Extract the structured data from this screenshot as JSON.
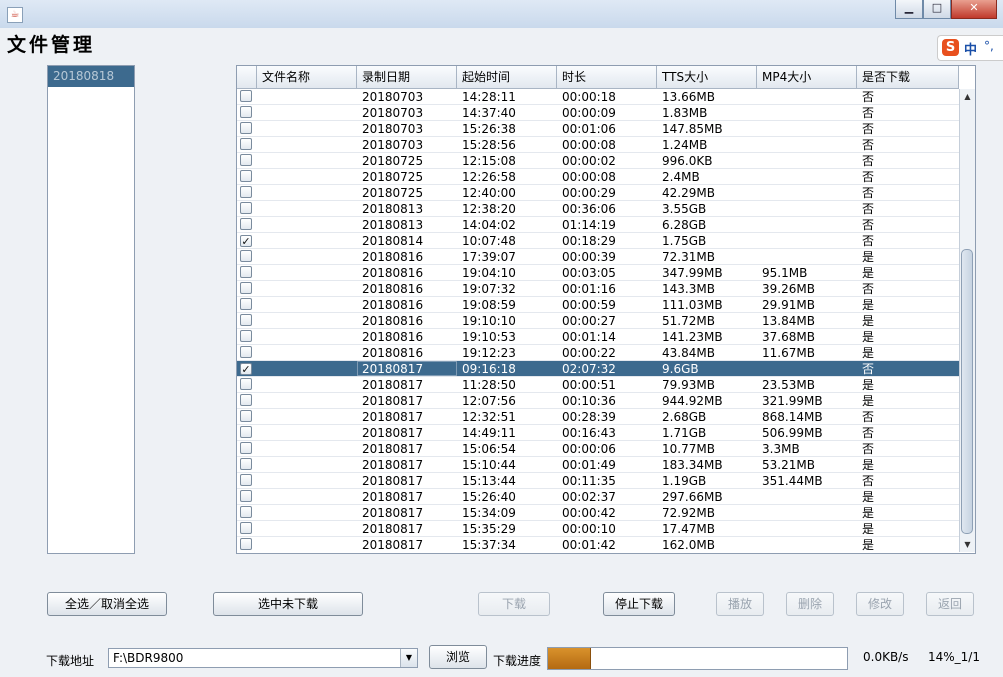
{
  "window": {
    "title_icon": "java-app-icon"
  },
  "page_title": "文件管理",
  "ime": {
    "logo": "S",
    "mode": "中",
    "indicator": "°,"
  },
  "date_list": [
    "20180818"
  ],
  "table": {
    "columns": [
      "文件名称",
      "录制日期",
      "起始时间",
      "时长",
      "TTS大小",
      "MP4大小",
      "是否下载"
    ],
    "rows": [
      {
        "checked": false,
        "name": "",
        "date": "20180703",
        "start": "14:28:11",
        "duration": "00:00:18",
        "tts": "13.66MB",
        "mp4": "",
        "downloaded": "否"
      },
      {
        "checked": false,
        "name": "",
        "date": "20180703",
        "start": "14:37:40",
        "duration": "00:00:09",
        "tts": "1.83MB",
        "mp4": "",
        "downloaded": "否"
      },
      {
        "checked": false,
        "name": "",
        "date": "20180703",
        "start": "15:26:38",
        "duration": "00:01:06",
        "tts": "147.85MB",
        "mp4": "",
        "downloaded": "否"
      },
      {
        "checked": false,
        "name": "",
        "date": "20180703",
        "start": "15:28:56",
        "duration": "00:00:08",
        "tts": "1.24MB",
        "mp4": "",
        "downloaded": "否"
      },
      {
        "checked": false,
        "name": "",
        "date": "20180725",
        "start": "12:15:08",
        "duration": "00:00:02",
        "tts": "996.0KB",
        "mp4": "",
        "downloaded": "否"
      },
      {
        "checked": false,
        "name": "",
        "date": "20180725",
        "start": "12:26:58",
        "duration": "00:00:08",
        "tts": "2.4MB",
        "mp4": "",
        "downloaded": "否"
      },
      {
        "checked": false,
        "name": "",
        "date": "20180725",
        "start": "12:40:00",
        "duration": "00:00:29",
        "tts": "42.29MB",
        "mp4": "",
        "downloaded": "否"
      },
      {
        "checked": false,
        "name": "",
        "date": "20180813",
        "start": "12:38:20",
        "duration": "00:36:06",
        "tts": "3.55GB",
        "mp4": "",
        "downloaded": "否"
      },
      {
        "checked": false,
        "name": "",
        "date": "20180813",
        "start": "14:04:02",
        "duration": "01:14:19",
        "tts": "6.28GB",
        "mp4": "",
        "downloaded": "否"
      },
      {
        "checked": true,
        "name": "",
        "date": "20180814",
        "start": "10:07:48",
        "duration": "00:18:29",
        "tts": "1.75GB",
        "mp4": "",
        "downloaded": "否"
      },
      {
        "checked": false,
        "name": "",
        "date": "20180816",
        "start": "17:39:07",
        "duration": "00:00:39",
        "tts": "72.31MB",
        "mp4": "",
        "downloaded": "是"
      },
      {
        "checked": false,
        "name": "",
        "date": "20180816",
        "start": "19:04:10",
        "duration": "00:03:05",
        "tts": "347.99MB",
        "mp4": "95.1MB",
        "downloaded": "是"
      },
      {
        "checked": false,
        "name": "",
        "date": "20180816",
        "start": "19:07:32",
        "duration": "00:01:16",
        "tts": "143.3MB",
        "mp4": "39.26MB",
        "downloaded": "否"
      },
      {
        "checked": false,
        "name": "",
        "date": "20180816",
        "start": "19:08:59",
        "duration": "00:00:59",
        "tts": "111.03MB",
        "mp4": "29.91MB",
        "downloaded": "是"
      },
      {
        "checked": false,
        "name": "",
        "date": "20180816",
        "start": "19:10:10",
        "duration": "00:00:27",
        "tts": "51.72MB",
        "mp4": "13.84MB",
        "downloaded": "是"
      },
      {
        "checked": false,
        "name": "",
        "date": "20180816",
        "start": "19:10:53",
        "duration": "00:01:14",
        "tts": "141.23MB",
        "mp4": "37.68MB",
        "downloaded": "是"
      },
      {
        "checked": false,
        "name": "",
        "date": "20180816",
        "start": "19:12:23",
        "duration": "00:00:22",
        "tts": "43.84MB",
        "mp4": "11.67MB",
        "downloaded": "是"
      },
      {
        "checked": true,
        "name": "",
        "date": "20180817",
        "start": "09:16:18",
        "duration": "02:07:32",
        "tts": "9.6GB",
        "mp4": "",
        "downloaded": "否",
        "selected": true
      },
      {
        "checked": false,
        "name": "",
        "date": "20180817",
        "start": "11:28:50",
        "duration": "00:00:51",
        "tts": "79.93MB",
        "mp4": "23.53MB",
        "downloaded": "是"
      },
      {
        "checked": false,
        "name": "",
        "date": "20180817",
        "start": "12:07:56",
        "duration": "00:10:36",
        "tts": "944.92MB",
        "mp4": "321.99MB",
        "downloaded": "是"
      },
      {
        "checked": false,
        "name": "",
        "date": "20180817",
        "start": "12:32:51",
        "duration": "00:28:39",
        "tts": "2.68GB",
        "mp4": "868.14MB",
        "downloaded": "否"
      },
      {
        "checked": false,
        "name": "",
        "date": "20180817",
        "start": "14:49:11",
        "duration": "00:16:43",
        "tts": "1.71GB",
        "mp4": "506.99MB",
        "downloaded": "否"
      },
      {
        "checked": false,
        "name": "",
        "date": "20180817",
        "start": "15:06:54",
        "duration": "00:00:06",
        "tts": "10.77MB",
        "mp4": "3.3MB",
        "downloaded": "否"
      },
      {
        "checked": false,
        "name": "",
        "date": "20180817",
        "start": "15:10:44",
        "duration": "00:01:49",
        "tts": "183.34MB",
        "mp4": "53.21MB",
        "downloaded": "是"
      },
      {
        "checked": false,
        "name": "",
        "date": "20180817",
        "start": "15:13:44",
        "duration": "00:11:35",
        "tts": "1.19GB",
        "mp4": "351.44MB",
        "downloaded": "否"
      },
      {
        "checked": false,
        "name": "",
        "date": "20180817",
        "start": "15:26:40",
        "duration": "00:02:37",
        "tts": "297.66MB",
        "mp4": "",
        "downloaded": "是"
      },
      {
        "checked": false,
        "name": "",
        "date": "20180817",
        "start": "15:34:09",
        "duration": "00:00:42",
        "tts": "72.92MB",
        "mp4": "",
        "downloaded": "是"
      },
      {
        "checked": false,
        "name": "",
        "date": "20180817",
        "start": "15:35:29",
        "duration": "00:00:10",
        "tts": "17.47MB",
        "mp4": "",
        "downloaded": "是"
      },
      {
        "checked": false,
        "name": "",
        "date": "20180817",
        "start": "15:37:34",
        "duration": "00:01:42",
        "tts": "162.0MB",
        "mp4": "",
        "downloaded": "是"
      }
    ]
  },
  "buttons": {
    "select_all": "全选／取消全选",
    "select_not_downloaded": "选中未下载",
    "download": "下载",
    "stop_download": "停止下载",
    "play": "播放",
    "delete": "删除",
    "modify": "修改",
    "back": "返回"
  },
  "footer": {
    "path_label": "下载地址",
    "path_value": "F:\\BDR9800",
    "browse": "浏览",
    "progress_label": "下载进度",
    "progress_fraction": 0.14,
    "speed": "0.0KB/s",
    "progress_text": "14%_1/1"
  },
  "icons": {
    "minimize": "minimize-icon",
    "maximize": "maximize-icon",
    "close": "close-icon"
  }
}
